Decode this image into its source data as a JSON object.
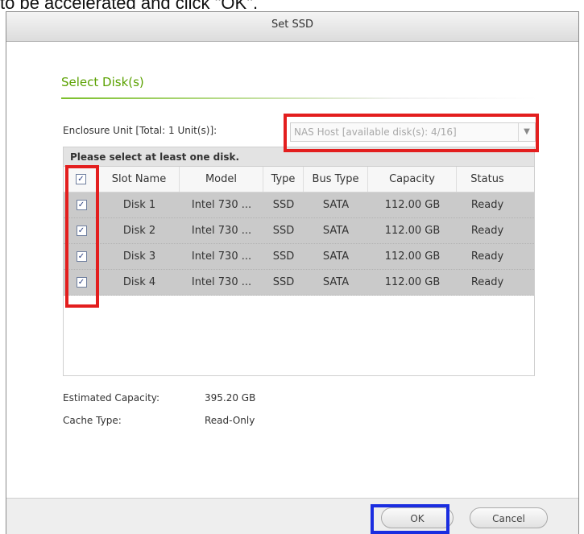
{
  "caption": "to be accelerated and click \"OK\".",
  "dialog": {
    "title": "Set SSD",
    "section_title": "Select Disk(s)",
    "enclosure_label": "Enclosure Unit [Total: 1 Unit(s)]:",
    "enclosure_select_value": "NAS Host [available disk(s): 4/16]",
    "grid_hint": "Please select at least one disk.",
    "columns": [
      "Slot Name",
      "Model",
      "Type",
      "Bus Type",
      "Capacity",
      "Status"
    ],
    "disks": [
      {
        "checked": true,
        "slot": "Disk 1",
        "model": "Intel 730 ...",
        "type": "SSD",
        "bus": "SATA",
        "capacity": "112.00 GB",
        "status": "Ready"
      },
      {
        "checked": true,
        "slot": "Disk 2",
        "model": "Intel 730 ...",
        "type": "SSD",
        "bus": "SATA",
        "capacity": "112.00 GB",
        "status": "Ready"
      },
      {
        "checked": true,
        "slot": "Disk 3",
        "model": "Intel 730 ...",
        "type": "SSD",
        "bus": "SATA",
        "capacity": "112.00 GB",
        "status": "Ready"
      },
      {
        "checked": true,
        "slot": "Disk 4",
        "model": "Intel 730 ...",
        "type": "SSD",
        "bus": "SATA",
        "capacity": "112.00 GB",
        "status": "Ready"
      }
    ],
    "estimated_capacity_label": "Estimated Capacity:",
    "estimated_capacity_value": "395.20 GB",
    "cache_type_label": "Cache Type:",
    "cache_type_value": "Read-Only",
    "ok_label": "OK",
    "cancel_label": "Cancel"
  },
  "colors": {
    "section_title": "#5aa100",
    "highlight_red": "#e31e1e",
    "highlight_blue": "#1a2de0",
    "selected_row": "#cacaca"
  }
}
